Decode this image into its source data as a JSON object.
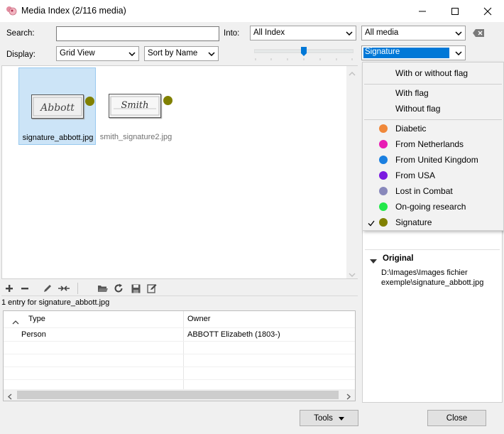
{
  "window": {
    "title": "Media Index (2/116 media)"
  },
  "search": {
    "label": "Search:",
    "value": ""
  },
  "into": {
    "label": "Into:",
    "selected": "All Index"
  },
  "media_filter": {
    "selected": "All media"
  },
  "display": {
    "label": "Display:",
    "view": "Grid View",
    "sort": "Sort by Name"
  },
  "zoom_slider": {
    "value": 0.5
  },
  "flag_filter": {
    "selected": "Signature"
  },
  "media_items": [
    {
      "filename": "signature_abbott.jpg",
      "signature_text": "Abbott",
      "selected": true
    },
    {
      "filename": "smith_signature2.jpg",
      "signature_text": "Smith",
      "selected": false
    }
  ],
  "entries": {
    "count_text": "1 entry for signature_abbott.jpg",
    "columns": [
      "Type",
      "Owner"
    ],
    "rows": [
      {
        "type": "Person",
        "owner": "ABBOTT Elizabeth (1803-)"
      }
    ]
  },
  "buttons": {
    "tools": "Tools",
    "close": "Close"
  },
  "details": {
    "section_title": "Original",
    "path": "D:\\Images\\Images fichier exemple\\signature_abbott.jpg"
  },
  "flag_menu": {
    "items": [
      {
        "label": "With or without flag"
      },
      {
        "label": "With flag"
      },
      {
        "label": "Without flag"
      },
      {
        "label": "Diabetic",
        "color": "#f0883a"
      },
      {
        "label": "From Netherlands",
        "color": "#e81cb4"
      },
      {
        "label": "From United Kingdom",
        "color": "#1a7fe0"
      },
      {
        "label": "From USA",
        "color": "#7a1ae0"
      },
      {
        "label": "Lost in Combat",
        "color": "#8888bb"
      },
      {
        "label": "On-going research",
        "color": "#22e84a"
      },
      {
        "label": "Signature",
        "color": "#808000",
        "checked": true
      }
    ]
  },
  "colors": {
    "selection": "#cce4f7",
    "accent": "#0078d7",
    "signature_flag": "#808000"
  }
}
